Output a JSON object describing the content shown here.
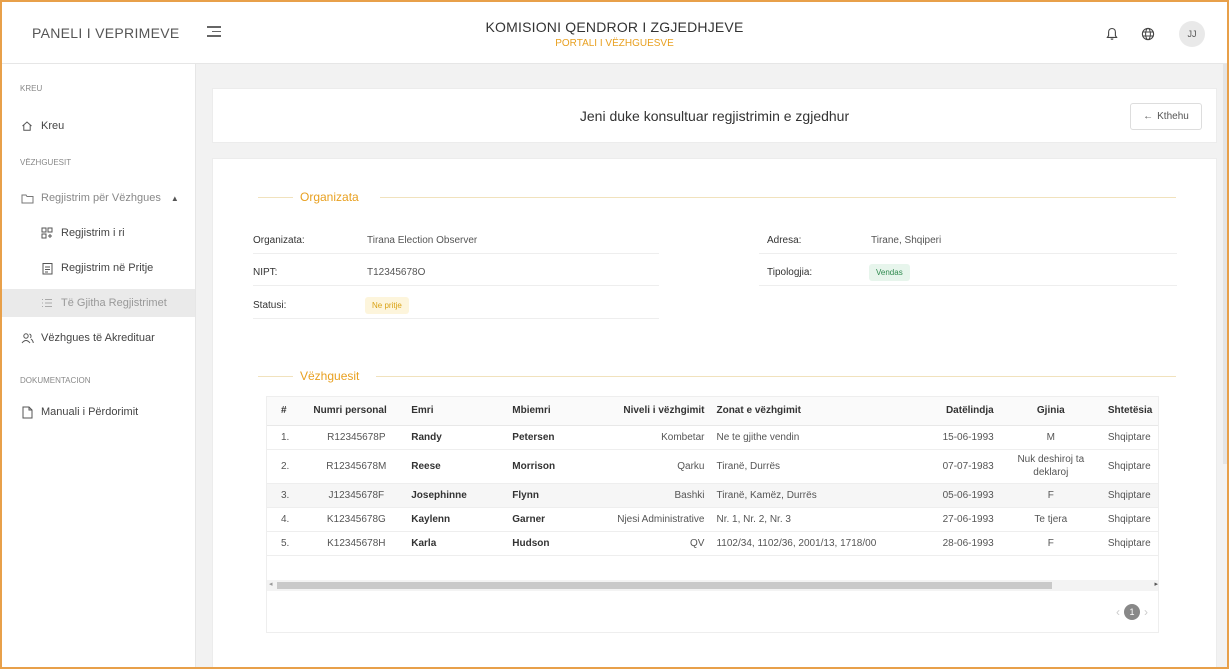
{
  "header": {
    "brand": "PANELI I VEPRIMEVE",
    "title": "KOMISIONI QENDROR I ZGJEDHJEVE",
    "subtitle": "PORTALI I VËZHGUESVE",
    "avatar": "JJ"
  },
  "sidebar": {
    "section_kreu": "KREU",
    "kreu": "Kreu",
    "section_vezhguesit": "VËZHGUESIT",
    "group": "Regjistrim për Vëzhgues",
    "new_reg": "Regjistrim i ri",
    "pending": "Regjistrim në Pritje",
    "all": "Të Gjitha Regjistrimet",
    "accredited": "Vëzhgues të Akredituar",
    "section_doc": "DOKUMENTACION",
    "manual": "Manuali i Përdorimit"
  },
  "banner": {
    "title": "Jeni duke konsultuar regjistrimin e zgjedhur",
    "back": "Kthehu"
  },
  "organization": {
    "legend": "Organizata",
    "org_label": "Organizata:",
    "org_value": "Tirana Election Observer",
    "nipt_label": "NIPT:",
    "nipt_value": "T12345678O",
    "status_label": "Statusi:",
    "status_value": "Ne pritje",
    "address_label": "Adresa:",
    "address_value": "Tirane, Shqiperi",
    "type_label": "Tipologjia:",
    "type_value": "Vendas"
  },
  "observers": {
    "legend": "Vëzhguesit",
    "columns": [
      "#",
      "Numri personal",
      "Emri",
      "Mbiemri",
      "Niveli i vëzhgimit",
      "Zonat e vëzhgimit",
      "Datëlindja",
      "Gjinia",
      "Shtetësia"
    ],
    "rows": [
      [
        "1.",
        "R12345678P",
        "Randy",
        "Petersen",
        "Kombetar",
        "Ne te gjithe vendin",
        "15-06-1993",
        "M",
        "Shqiptare"
      ],
      [
        "2.",
        "R12345678M",
        "Reese",
        "Morrison",
        "Qarku",
        "Tiranë, Durrës",
        "07-07-1983",
        "Nuk deshiroj ta deklaroj",
        "Shqiptare"
      ],
      [
        "3.",
        "J12345678F",
        "Josephinne",
        "Flynn",
        "Bashki",
        "Tiranë, Kamëz, Durrës",
        "05-06-1993",
        "F",
        "Shqiptare"
      ],
      [
        "4.",
        "K12345678G",
        "Kaylenn",
        "Garner",
        "Njesi Administrative",
        "Nr. 1, Nr. 2, Nr. 3",
        "27-06-1993",
        "Te tjera",
        "Shqiptare"
      ],
      [
        "5.",
        "K12345678H",
        "Karla",
        "Hudson",
        "QV",
        "1102/34, 1102/36, 2001/13, 1718/00",
        "28-06-1993",
        "F",
        "Shqiptare"
      ]
    ],
    "page": "1"
  }
}
